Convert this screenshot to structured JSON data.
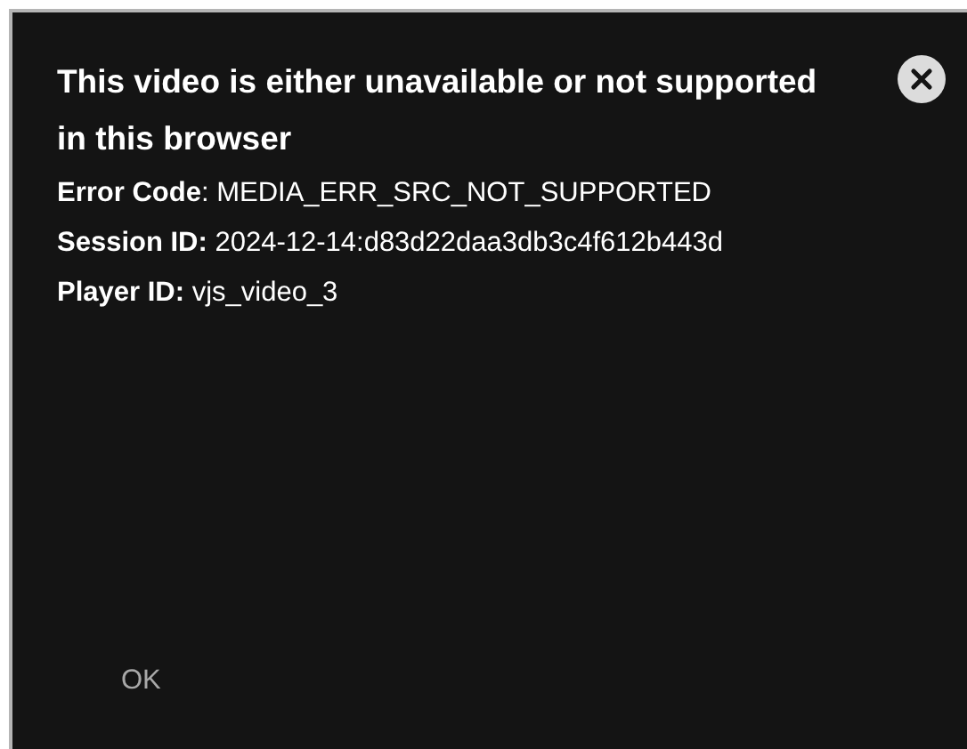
{
  "dialog": {
    "title": "This video is either unavailable or not supported in this browser",
    "details": [
      "**Error Code**: MEDIA_ERR_SRC_NOT_SUPPORTED",
      "**Session ID:** 2024-12-14:d83d22daa3db3c4f612b443d",
      "**Player ID:** vjs_video_3"
    ],
    "button": "OK"
  }
}
